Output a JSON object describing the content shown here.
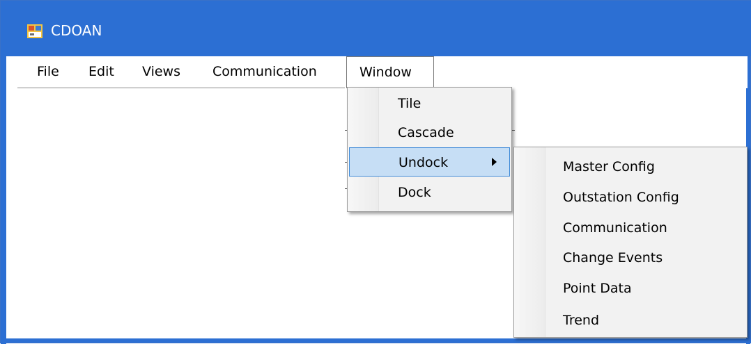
{
  "window": {
    "title": "CDOAN",
    "icon": "app-window-icon"
  },
  "menubar": {
    "items": [
      {
        "label": "File"
      },
      {
        "label": "Edit"
      },
      {
        "label": "Views"
      },
      {
        "label": "Communication"
      },
      {
        "label": "Window"
      }
    ]
  },
  "window_menu": {
    "items": [
      {
        "label": "Tile"
      },
      {
        "label": "Cascade"
      },
      {
        "label": "Undock",
        "has_submenu": true,
        "highlighted": true
      },
      {
        "label": "Dock"
      }
    ]
  },
  "undock_submenu": {
    "items": [
      {
        "label": "Master Config"
      },
      {
        "label": "Outstation Config"
      },
      {
        "label": "Communication"
      },
      {
        "label": "Change Events"
      },
      {
        "label": "Point Data"
      },
      {
        "label": "Trend"
      }
    ]
  },
  "colors": {
    "titlebar": "#2c6fd3",
    "highlight_fill": "#c6def5",
    "highlight_border": "#3e8ad8",
    "menu_background": "#f2f2f2"
  }
}
